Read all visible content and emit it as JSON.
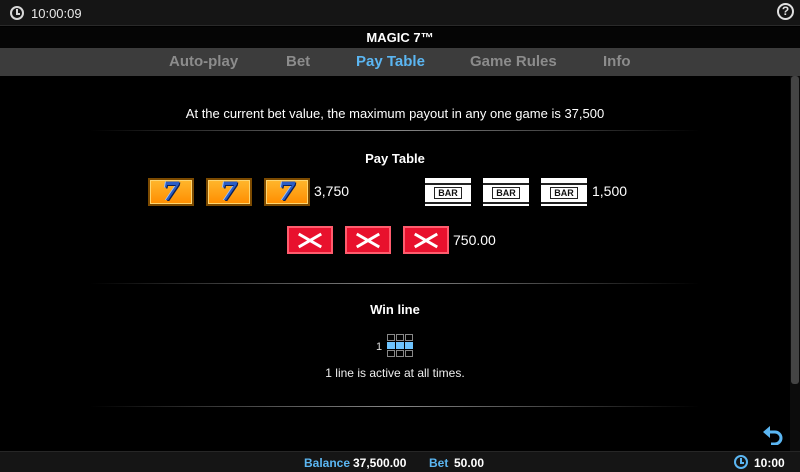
{
  "status_bar": {
    "time": "10:00:09",
    "help_icon": "question-circle-icon",
    "clock_icon": "clock-icon"
  },
  "title": "MAGIC 7™",
  "tabs": [
    {
      "label": "Auto-play",
      "active": false
    },
    {
      "label": "Bet",
      "active": false
    },
    {
      "label": "Pay Table",
      "active": true
    },
    {
      "label": "Game Rules",
      "active": false
    },
    {
      "label": "Info",
      "active": false
    }
  ],
  "max_payout_text": "At the current bet value, the maximum payout in any one game is 37,500",
  "pay_table": {
    "heading": "Pay Table",
    "rows": [
      {
        "symbol": "seven",
        "count": 3,
        "payout": "3,750"
      },
      {
        "symbol": "bar",
        "label": "BAR",
        "count": 3,
        "payout": "1,500"
      },
      {
        "symbol": "cross",
        "count": 3,
        "payout": "750.00"
      }
    ]
  },
  "win_line": {
    "heading": "Win line",
    "line_number": "1",
    "active_rows": [
      1
    ],
    "active_text": "1 line is active at all times."
  },
  "bottom_bar": {
    "balance_label": "Balance",
    "balance_value": "37,500.00",
    "bet_label": "Bet",
    "bet_value": "50.00",
    "time": "10:00",
    "back_icon": "undo-arrow-icon"
  },
  "colors": {
    "accent": "#5bb6f2",
    "tab_inactive": "#8c8c8c",
    "tab_bar": "#3c3c3c",
    "seven_bg": "#ff9f1a",
    "cross_bg": "#e8112d"
  }
}
